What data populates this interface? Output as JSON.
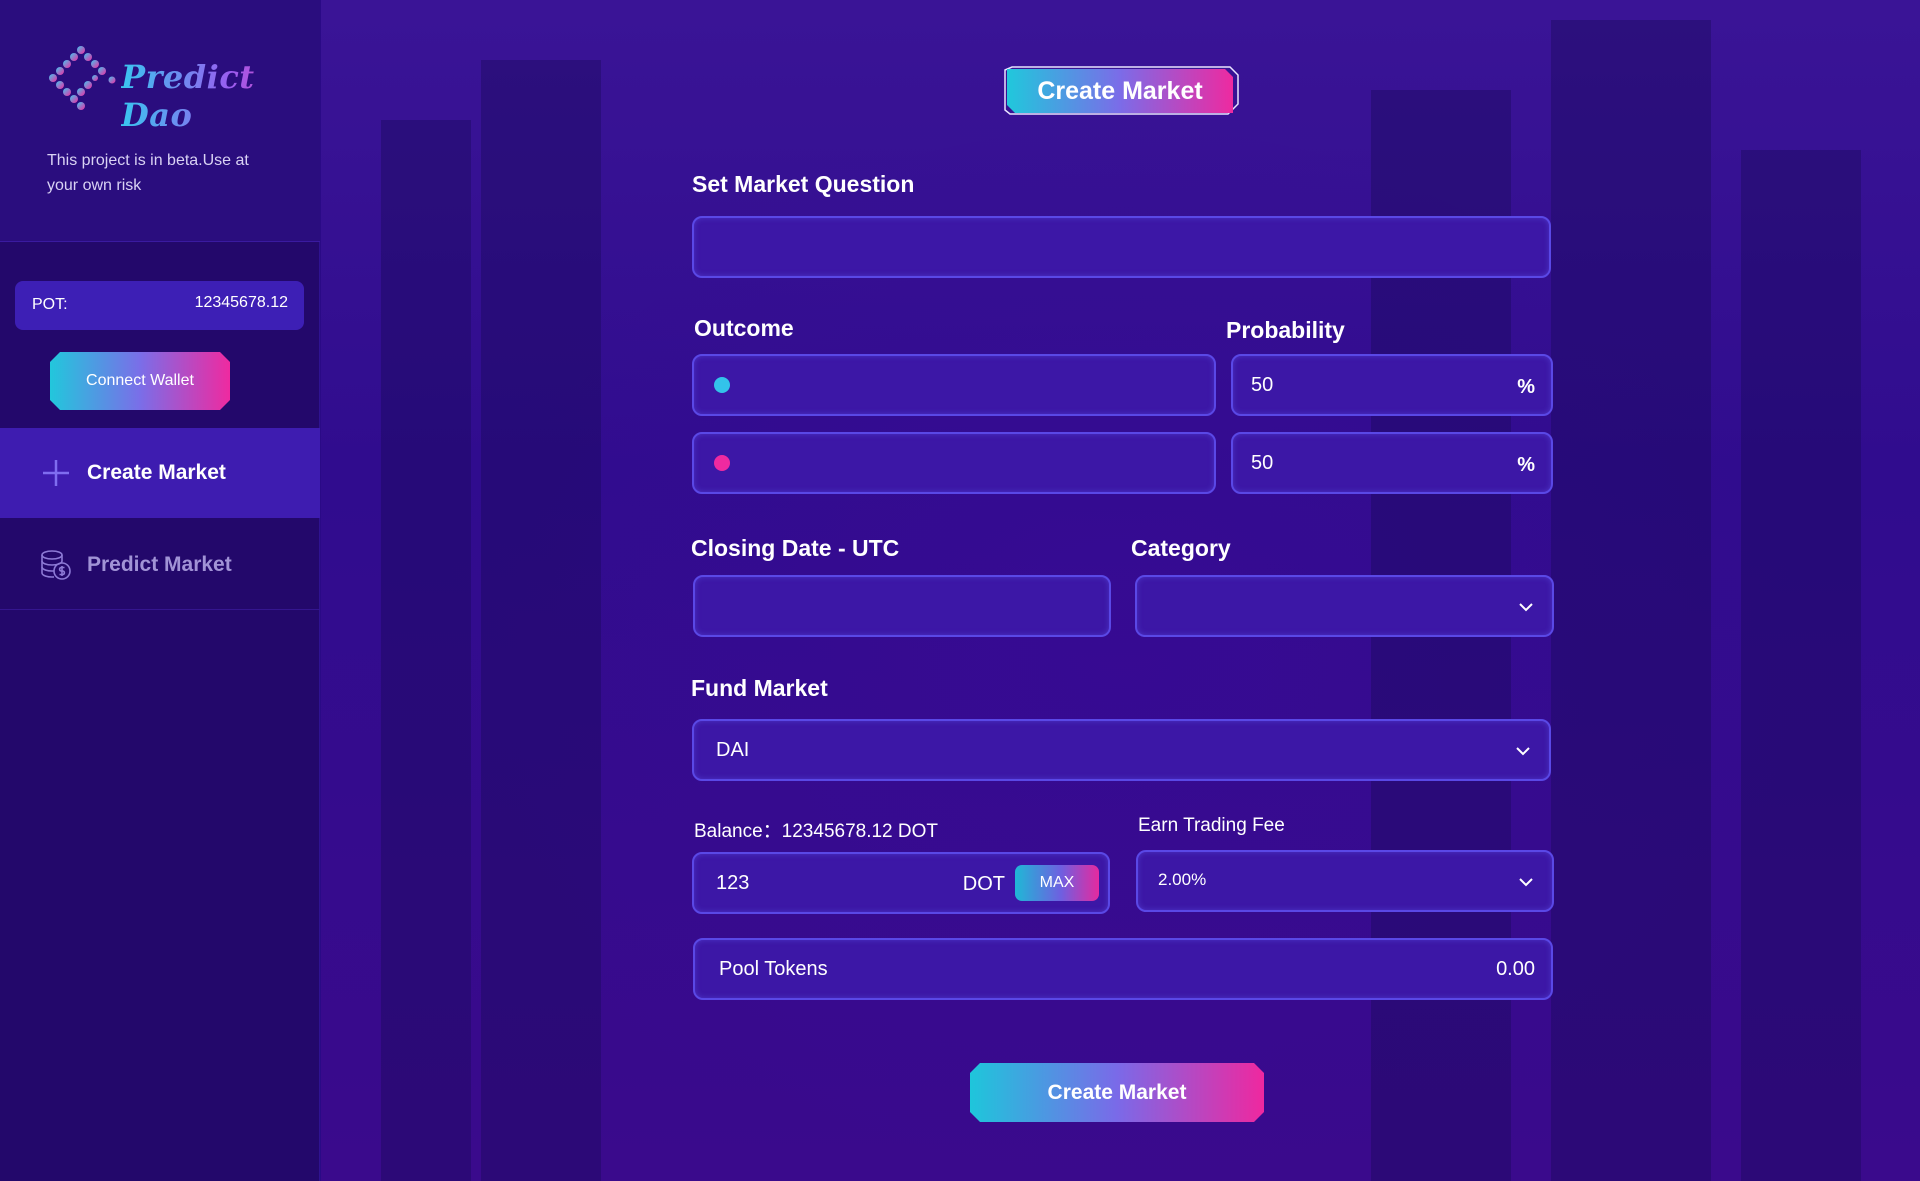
{
  "brand": {
    "name": "Predict Dao",
    "beta_note": "This project is in beta.Use at your own risk"
  },
  "pot": {
    "label": "POT:",
    "value": "12345678.12"
  },
  "wallet": {
    "connect_label": "Connect Wallet"
  },
  "nav": {
    "items": [
      {
        "label": "Create Market",
        "icon": "plus-icon",
        "active": true
      },
      {
        "label": "Predict Market",
        "icon": "coins-icon",
        "active": false
      }
    ]
  },
  "form": {
    "title": "Create Market",
    "question": {
      "label": "Set Market Question",
      "value": ""
    },
    "outcome_label": "Outcome",
    "probability_label": "Probability",
    "outcomes": [
      {
        "value": "",
        "color": "#33c3ea",
        "probability": "50",
        "unit": "%"
      },
      {
        "value": "",
        "color": "#ee2aa0",
        "probability": "50",
        "unit": "%"
      }
    ],
    "closing_date": {
      "label": "Closing Date - UTC",
      "value": ""
    },
    "category": {
      "label": "Category",
      "value": ""
    },
    "fund_market": {
      "label": "Fund Market",
      "value": "DAI"
    },
    "balance": {
      "label": "Balance：",
      "value": "12345678.12 DOT"
    },
    "amount": {
      "value": "123",
      "unit": "DOT",
      "max_label": "MAX"
    },
    "trading_fee": {
      "label": "Earn Trading Fee",
      "value": "2.00%"
    },
    "pool_tokens": {
      "label": "Pool Tokens",
      "value": "0.00"
    },
    "submit_label": "Create Market"
  },
  "colors": {
    "accent_cyan": "#20c8dc",
    "accent_pink": "#ee2aa0",
    "background": "#2a0a86"
  }
}
